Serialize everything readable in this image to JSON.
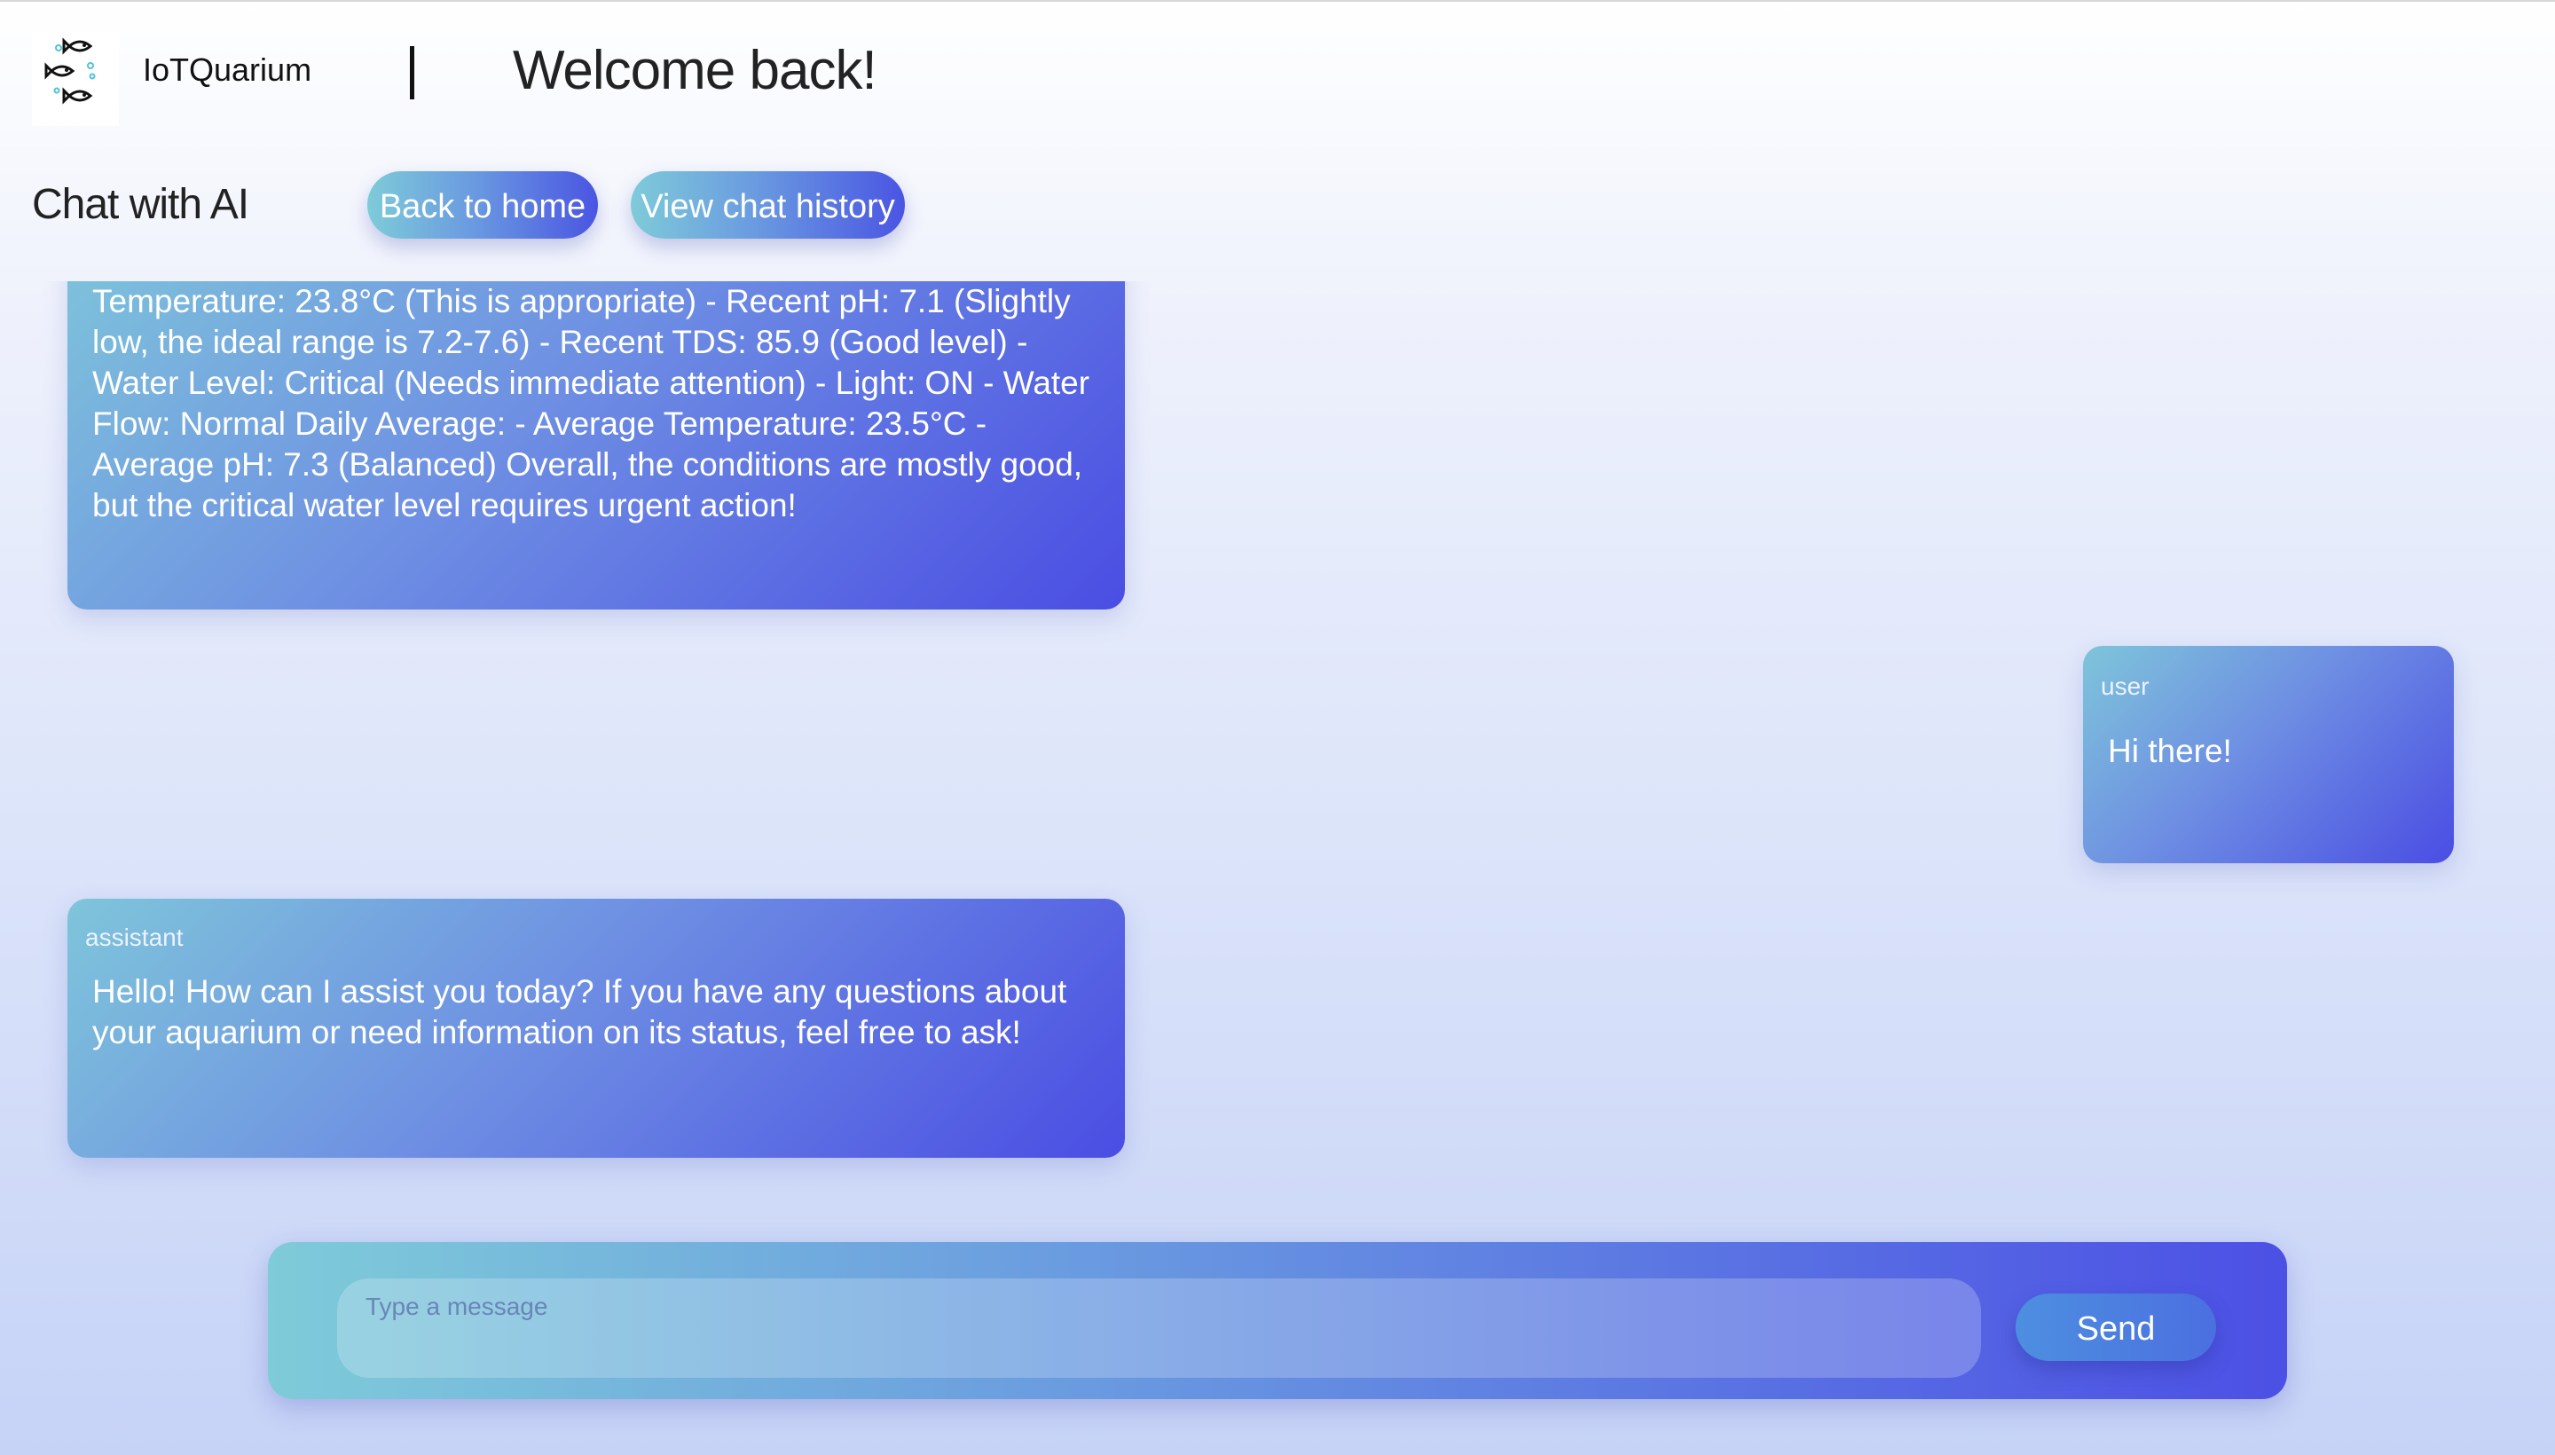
{
  "header": {
    "brand": "IoTQuarium",
    "welcome": "Welcome back!",
    "subtitle": "Chat with AI",
    "back_label": "Back to home",
    "history_label": "View chat history"
  },
  "messages": [
    {
      "role": "",
      "text": "Temperature: 23.8°C (This is appropriate) - Recent pH: 7.1 (Slightly low, the ideal range is 7.2-7.6) - Recent TDS: 85.9 (Good level) - Water Level: Critical (Needs immediate attention) - Light: ON - Water Flow: Normal Daily Average: - Average Temperature: 23.5°C - Average pH: 7.3 (Balanced) Overall, the conditions are mostly good, but the critical water level requires urgent action!"
    },
    {
      "role": "user",
      "text": "Hi there!"
    },
    {
      "role": "assistant",
      "text": "Hello! How can I assist you today? If you have any questions about your aquarium or need information on its status, feel free to ask!"
    }
  ],
  "composer": {
    "placeholder": "Type a message",
    "send_label": "Send"
  },
  "icons": {
    "logo": "fish-logo-icon"
  }
}
